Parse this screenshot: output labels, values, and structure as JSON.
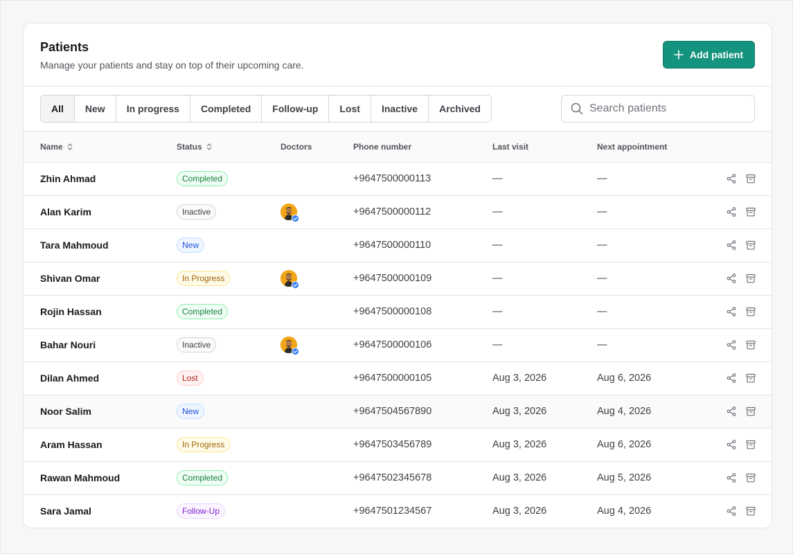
{
  "header": {
    "title": "Patients",
    "subtitle": "Manage your patients and stay on top of their upcoming care.",
    "add_button_label": "Add patient"
  },
  "tabs": [
    {
      "label": "All",
      "active": true
    },
    {
      "label": "New"
    },
    {
      "label": "In progress"
    },
    {
      "label": "Completed"
    },
    {
      "label": "Follow-up"
    },
    {
      "label": "Lost"
    },
    {
      "label": "Inactive"
    },
    {
      "label": "Archived"
    }
  ],
  "search": {
    "placeholder": "Search patients",
    "value": ""
  },
  "table": {
    "columns": {
      "name": "Name",
      "status": "Status",
      "doctors": "Doctors",
      "phone": "Phone number",
      "last_visit": "Last visit",
      "next_appointment": "Next appointment"
    },
    "rows": [
      {
        "name": "Zhin Ahmad",
        "status": "Completed",
        "status_key": "completed",
        "doctor": false,
        "phone": "+9647500000113",
        "last_visit": "—",
        "next_appointment": "—"
      },
      {
        "name": "Alan Karim",
        "status": "Inactive",
        "status_key": "inactive",
        "doctor": true,
        "phone": "+9647500000112",
        "last_visit": "—",
        "next_appointment": "—"
      },
      {
        "name": "Tara Mahmoud",
        "status": "New",
        "status_key": "new",
        "doctor": false,
        "phone": "+9647500000110",
        "last_visit": "—",
        "next_appointment": "—"
      },
      {
        "name": "Shivan Omar",
        "status": "In Progress",
        "status_key": "inprogress",
        "doctor": true,
        "phone": "+9647500000109",
        "last_visit": "—",
        "next_appointment": "—"
      },
      {
        "name": "Rojin Hassan",
        "status": "Completed",
        "status_key": "completed",
        "doctor": false,
        "phone": "+9647500000108",
        "last_visit": "—",
        "next_appointment": "—"
      },
      {
        "name": "Bahar Nouri",
        "status": "Inactive",
        "status_key": "inactive",
        "doctor": true,
        "phone": "+9647500000106",
        "last_visit": "—",
        "next_appointment": "—"
      },
      {
        "name": "Dilan Ahmed",
        "status": "Lost",
        "status_key": "lost",
        "doctor": false,
        "phone": "+9647500000105",
        "last_visit": "Aug 3, 2026",
        "next_appointment": "Aug 6, 2026"
      },
      {
        "name": "Noor Salim",
        "status": "New",
        "status_key": "new",
        "doctor": false,
        "phone": "+9647504567890",
        "last_visit": "Aug 3, 2026",
        "next_appointment": "Aug 4, 2026",
        "hover": true
      },
      {
        "name": "Aram Hassan",
        "status": "In Progress",
        "status_key": "inprogress",
        "doctor": false,
        "phone": "+9647503456789",
        "last_visit": "Aug 3, 2026",
        "next_appointment": "Aug 6, 2026"
      },
      {
        "name": "Rawan Mahmoud",
        "status": "Completed",
        "status_key": "completed",
        "doctor": false,
        "phone": "+9647502345678",
        "last_visit": "Aug 3, 2026",
        "next_appointment": "Aug 5, 2026"
      },
      {
        "name": "Sara Jamal",
        "status": "Follow-Up",
        "status_key": "followup",
        "doctor": false,
        "phone": "+9647501234567",
        "last_visit": "Aug 3, 2026",
        "next_appointment": "Aug 4, 2026"
      }
    ]
  },
  "colors": {
    "accent": "#14937f",
    "avatar_bg": "#f2a516",
    "verified": "#3b82f6"
  },
  "icons": {
    "add": "plus-icon",
    "search": "search-icon",
    "sort": "sort-icon",
    "share": "share-icon",
    "archive": "archive-icon",
    "verified": "verified-badge-icon"
  }
}
